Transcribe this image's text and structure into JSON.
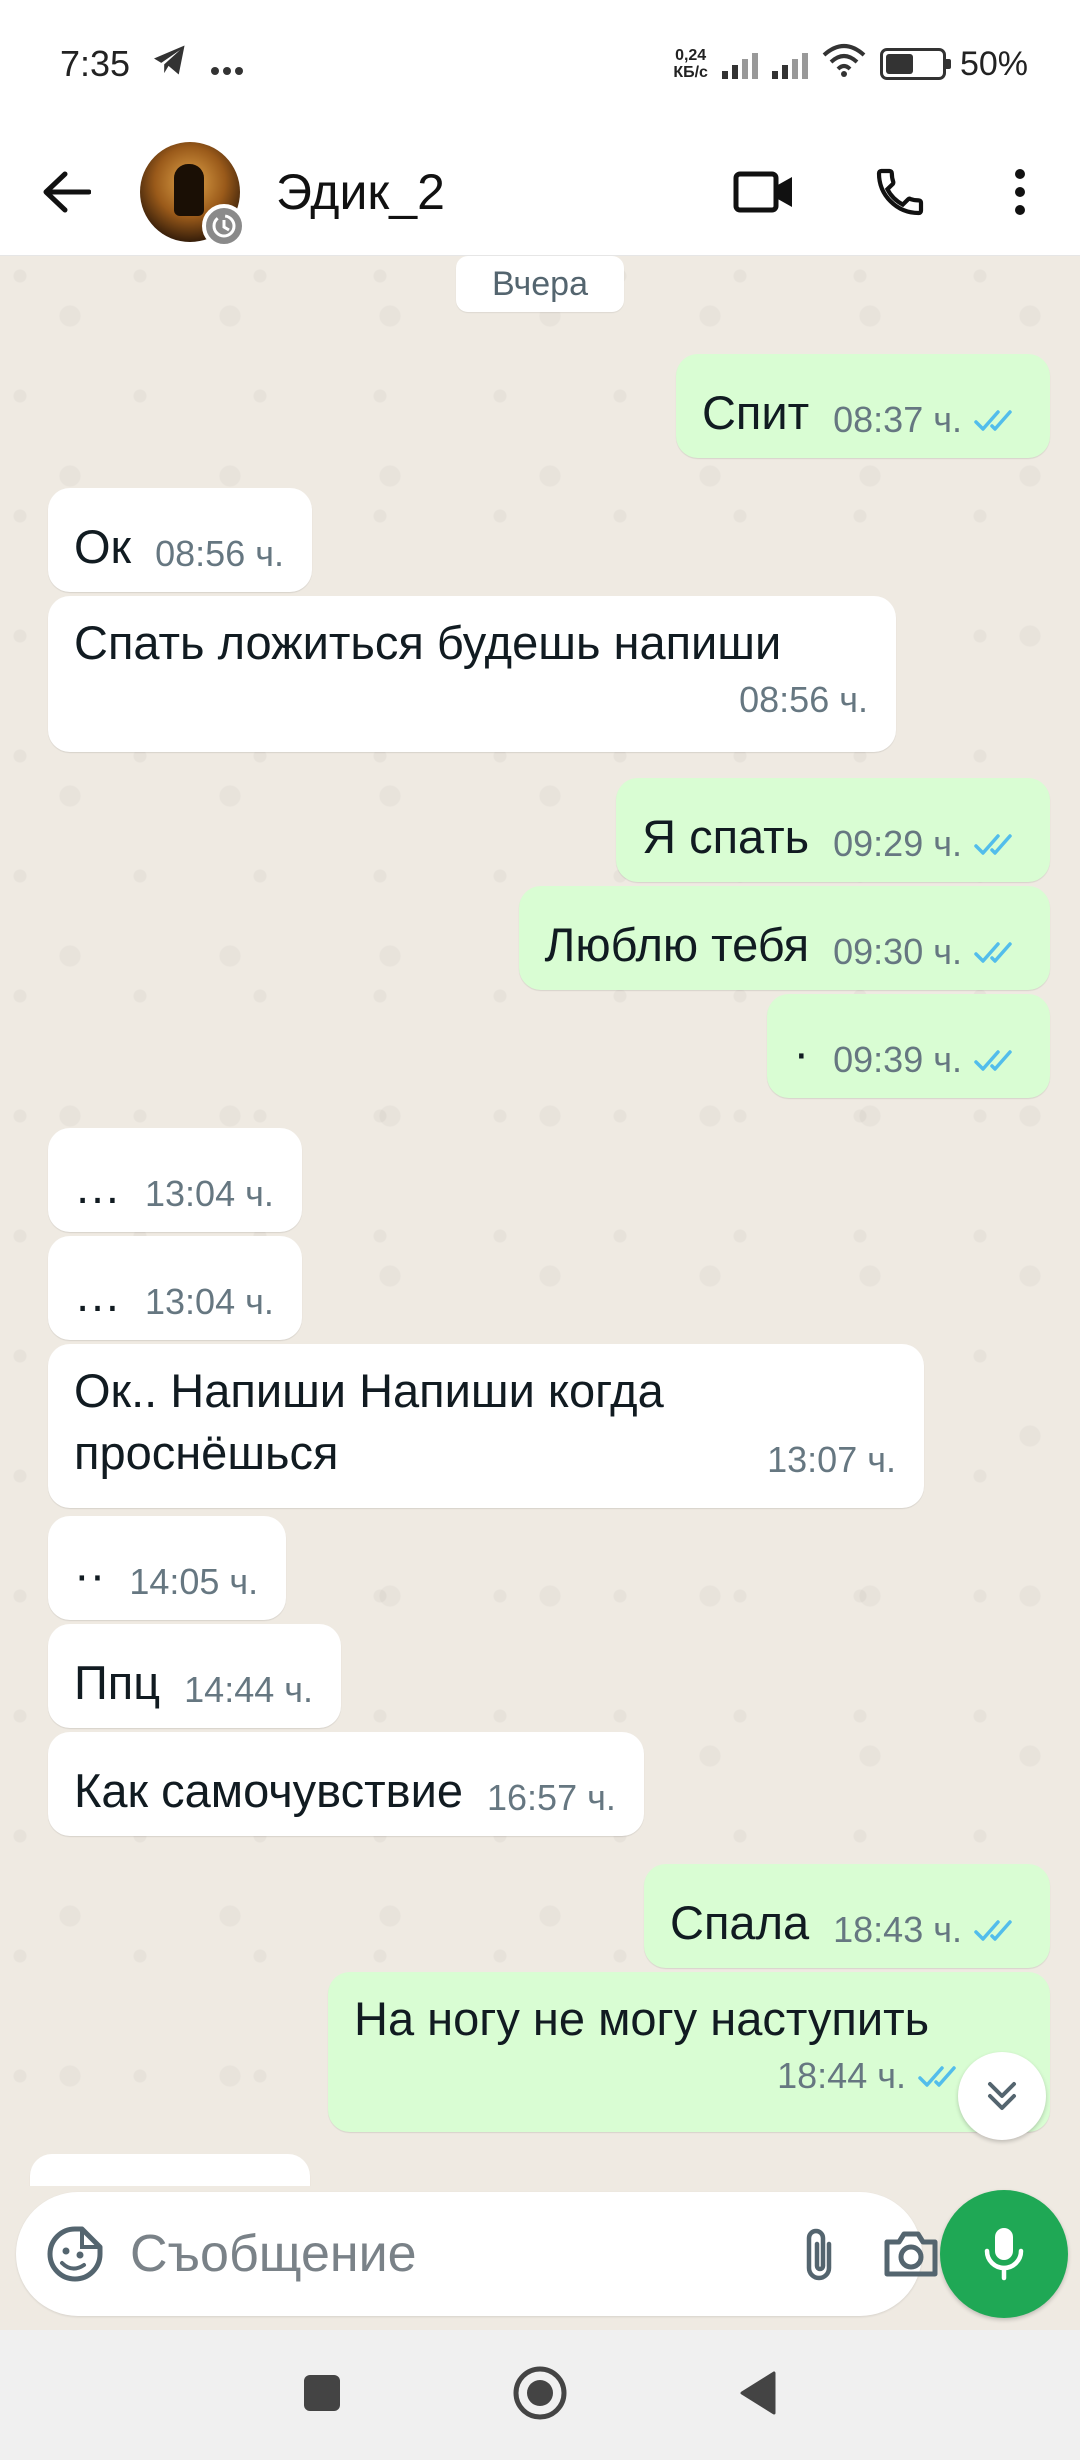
{
  "status_bar": {
    "time": "7:35",
    "net_speed_value": "0,24",
    "net_speed_unit": "КБ/с",
    "battery": "50%",
    "icons": [
      "telegram-icon",
      "more-dots-icon",
      "signal-icon",
      "wifi-icon",
      "battery-icon"
    ]
  },
  "header": {
    "contact_name": "Эдик_2",
    "icons": [
      "back-arrow-icon",
      "video-call-icon",
      "phone-icon",
      "more-vert-icon"
    ]
  },
  "chat": {
    "date_label": "Вчера",
    "messages": [
      {
        "dir": "out",
        "text": "Спит",
        "time": "08:37 ч.",
        "ticks": "read"
      },
      {
        "dir": "in",
        "text": "Ок",
        "time": "08:56 ч."
      },
      {
        "dir": "in",
        "text": "Спать ложиться будешь напиши",
        "time": "08:56 ч."
      },
      {
        "dir": "out",
        "text": "Я спать",
        "time": "09:29 ч.",
        "ticks": "read"
      },
      {
        "dir": "out",
        "text": "Люблю тебя",
        "time": "09:30 ч.",
        "ticks": "read"
      },
      {
        "dir": "out",
        "text": "·",
        "time": "09:39 ч.",
        "ticks": "read"
      },
      {
        "dir": "in",
        "text": "…",
        "time": "13:04 ч."
      },
      {
        "dir": "in",
        "text": "…",
        "time": "13:04 ч."
      },
      {
        "dir": "in",
        "text_line1": "Ок.. Напиши Напиши когда",
        "text_line2": "проснёшься",
        "time": "13:07 ч."
      },
      {
        "dir": "in",
        "text": "··",
        "time": "14:05 ч."
      },
      {
        "dir": "in",
        "text": "Ппц",
        "time": "14:44 ч."
      },
      {
        "dir": "in",
        "text": "Как самочувствие",
        "time": "16:57 ч."
      },
      {
        "dir": "out",
        "text": "Спала",
        "time": "18:43 ч.",
        "ticks": "read"
      },
      {
        "dir": "out",
        "text": "На ногу не могу наступить",
        "time": "18:44 ч.",
        "ticks": "read"
      }
    ]
  },
  "compose": {
    "placeholder": "Съобщение",
    "icons": [
      "emoji-sticker-icon",
      "attach-icon",
      "camera-icon",
      "mic-icon"
    ]
  },
  "colors": {
    "outgoing_bubble": "#d9fdd3",
    "incoming_bubble": "#ffffff",
    "read_ticks": "#53bdeb",
    "accent_green": "#1fa855",
    "chat_background": "#efeae2"
  }
}
